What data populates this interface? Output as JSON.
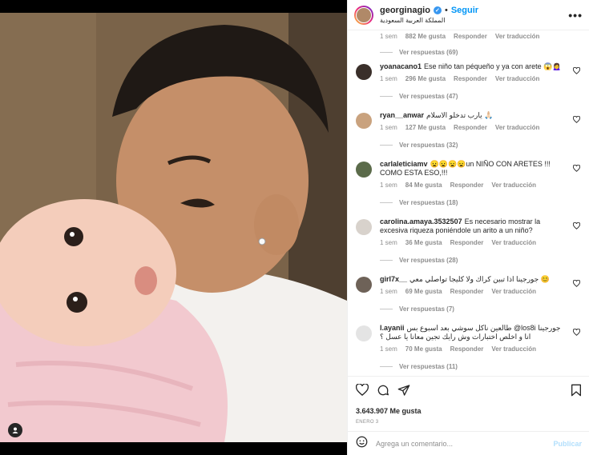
{
  "header": {
    "username": "georginagio",
    "separator": "•",
    "follow_label": "Seguir",
    "location": "المملكة العربية السعودية",
    "more_label": "•••"
  },
  "top_fragment": {
    "time": "1 sem",
    "likes": "882 Me gusta",
    "reply_label": "Responder",
    "translate_label": "Ver traducción",
    "replies_label": "Ver respuestas (69)"
  },
  "comments": [
    {
      "user": "yoanacano1",
      "text": "Ese niño tan péqueño y ya con arete 😱🙍‍♀️",
      "time": "1 sem",
      "likes": "296 Me gusta",
      "reply_label": "Responder",
      "translate_label": "Ver traducción",
      "replies_label": "Ver respuestas (47)",
      "avatar_color": "#3a2f2a"
    },
    {
      "user": "ryan__anwar",
      "text": "يارب تدخلو الاسلام 🙏🏻",
      "time": "1 sem",
      "likes": "127 Me gusta",
      "reply_label": "Responder",
      "translate_label": "Ver traducción",
      "replies_label": "Ver respuestas (32)",
      "avatar_color": "#c9a27e"
    },
    {
      "user": "carlaleticiamv",
      "text": "😦😦😦😦un NIÑO CON ARETES !!! COMO ESTA ESO,!!!",
      "time": "1 sem",
      "likes": "84 Me gusta",
      "reply_label": "Responder",
      "translate_label": "Ver traducción",
      "replies_label": "Ver respuestas (18)",
      "avatar_color": "#5b6b4a"
    },
    {
      "user": "carolina.amaya.3532507",
      "text": "Es necesario mostrar la excesiva riqueza poniéndole un arito a un niño?",
      "time": "1 sem",
      "likes": "36 Me gusta",
      "reply_label": "Responder",
      "translate_label": "Ver traducción",
      "replies_label": "Ver respuestas (28)",
      "avatar_color": "#d8d2cc"
    },
    {
      "user": "girl7x__",
      "text": "جورجينا اذا تبين كراك ولا كليجا تواصلي معي 😊",
      "time": "1 sem",
      "likes": "69 Me gusta",
      "reply_label": "Responder",
      "translate_label": "Ver traducción",
      "replies_label": "Ver respuestas (7)",
      "avatar_color": "#6e6258"
    },
    {
      "user": "l.ayanii",
      "text": "طالعين ناكل سوشي بعد اسبوع بس @los8i جورجينا انا و اخلص اختبارات وش رايك تجين معانا يا عسل ؟",
      "time": "1 sem",
      "likes": "70 Me gusta",
      "reply_label": "Responder",
      "translate_label": "Ver traducción",
      "replies_label": "Ver respuestas (11)",
      "avatar_color": "#e4e4e4"
    }
  ],
  "post": {
    "likes": "3.643.907 Me gusta",
    "date": "ENERO 3"
  },
  "composer": {
    "placeholder": "Agrega un comentario...",
    "post_label": "Publicar"
  },
  "icons": [
    "verified-icon",
    "more-icon",
    "heart-icon",
    "comment-icon",
    "share-icon",
    "bookmark-icon",
    "emoji-icon",
    "user-tag-icon"
  ]
}
